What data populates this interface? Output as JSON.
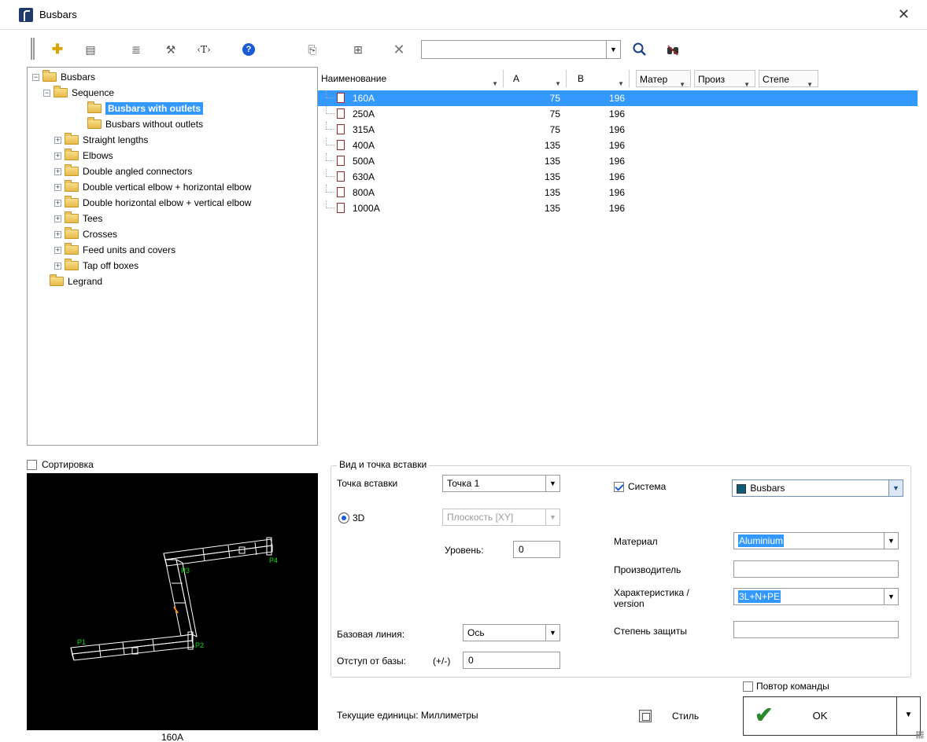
{
  "window": {
    "title": "Busbars",
    "close": "✕"
  },
  "toolbar": {
    "add": "✚",
    "properties": "▤",
    "list": "≣",
    "tools": "⚒",
    "tag": "‹T›",
    "help": "?",
    "copy": "⎘",
    "view": "⊞",
    "delete": "✕",
    "search_value": "",
    "combo_arrow": "▼",
    "search": "🔍",
    "find": "⛶"
  },
  "tree": {
    "items": [
      {
        "label": "Busbars",
        "level": 0,
        "expander": "−"
      },
      {
        "label": "Sequence",
        "level": 1,
        "expander": "−"
      },
      {
        "label": "Busbars with outlets",
        "level": 2,
        "expander": "",
        "selected": true
      },
      {
        "label": "Busbars without outlets",
        "level": 2,
        "expander": ""
      },
      {
        "label": "Straight lengths",
        "level": 1,
        "expander": "+"
      },
      {
        "label": "Elbows",
        "level": 1,
        "expander": "+"
      },
      {
        "label": "Double angled connectors",
        "level": 1,
        "expander": "+"
      },
      {
        "label": "Double vertical elbow + horizontal elbow",
        "level": 1,
        "expander": "+"
      },
      {
        "label": "Double horizontal elbow + vertical elbow",
        "level": 1,
        "expander": "+"
      },
      {
        "label": "Tees",
        "level": 1,
        "expander": "+"
      },
      {
        "label": "Crosses",
        "level": 1,
        "expander": "+"
      },
      {
        "label": "Feed units and covers",
        "level": 1,
        "expander": "+"
      },
      {
        "label": "Tap off boxes",
        "level": 1,
        "expander": "+"
      },
      {
        "label": "Legrand",
        "level": 0,
        "expander": ""
      }
    ]
  },
  "list": {
    "columns": [
      {
        "label": "Наименование",
        "arrow": "▼"
      },
      {
        "label": "A",
        "arrow": "▼"
      },
      {
        "label": "B",
        "arrow": "▼"
      },
      {
        "label": "Матер",
        "arrow": "▼"
      },
      {
        "label": "Произ",
        "arrow": "▼"
      },
      {
        "label": "Степе",
        "arrow": "▼"
      }
    ],
    "rows": [
      {
        "name": "160A",
        "a": "75",
        "b": "196",
        "selected": true
      },
      {
        "name": "250A",
        "a": "75",
        "b": "196"
      },
      {
        "name": "315A",
        "a": "75",
        "b": "196"
      },
      {
        "name": "400A",
        "a": "135",
        "b": "196"
      },
      {
        "name": "500A",
        "a": "135",
        "b": "196"
      },
      {
        "name": "630A",
        "a": "135",
        "b": "196"
      },
      {
        "name": "800A",
        "a": "135",
        "b": "196"
      },
      {
        "name": "1000A",
        "a": "135",
        "b": "196"
      }
    ]
  },
  "sort": {
    "label": "Сортировка",
    "checked": false
  },
  "preview": {
    "caption": "160A",
    "point_labels": [
      "P1",
      "P2",
      "P3",
      "P4"
    ],
    "colors": {
      "background": "#000000",
      "outline": "#ffffff",
      "points": "#00e000",
      "accent": "#ff8c00"
    }
  },
  "insert": {
    "group_title": "Вид и точка вставки",
    "point_label": "Точка вставки",
    "point_value": "Точка 1",
    "mode_3d": "3D",
    "plane_value": "Плоскость [XY]",
    "level_label": "Уровень:",
    "level_value": "0",
    "baseline_label": "Базовая линия:",
    "baseline_value": "Ось",
    "offset_label": "Отступ от базы:",
    "offset_sign": "(+/-)",
    "offset_value": "0"
  },
  "props": {
    "system_label": "Система",
    "system_value": "Busbars",
    "system_color": "#0e5d78",
    "material_label": "Материал",
    "material_value": "Aluminium",
    "manufacturer_label": "Производитель",
    "manufacturer_value": "",
    "characteristic_label_1": "Характеристика /",
    "characteristic_label_2": "version",
    "characteristic_value": "3L+N+PE",
    "protection_label": "Степень защиты",
    "protection_value": ""
  },
  "footer": {
    "repeat_label": "Повтор команды",
    "units_text": "Текущие единицы: Миллиметры",
    "style_label": "Стиль",
    "ok_label": "OK",
    "ok_check": "✔",
    "split_arrow": "▼"
  }
}
